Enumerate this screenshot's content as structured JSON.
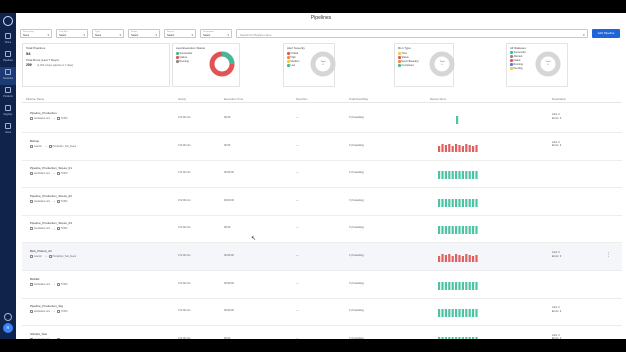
{
  "title": "Pipelines",
  "sidebar": {
    "items": [
      {
        "label": "Home"
      },
      {
        "label": "Pipelines"
      },
      {
        "label": "Networks"
      },
      {
        "label": "Products"
      },
      {
        "label": "Registry"
      },
      {
        "label": "Users"
      }
    ],
    "avatar": "R"
  },
  "filters": [
    {
      "label": "Processing",
      "value": "None"
    },
    {
      "label": "Last Run",
      "value": "Select"
    },
    {
      "label": "Type",
      "value": "None"
    },
    {
      "label": "Status",
      "value": "Select"
    },
    {
      "label": "Source",
      "value": "Select"
    },
    {
      "label": "Destination",
      "value": "Select"
    }
  ],
  "search": {
    "placeholder": "Search for Pipeline name"
  },
  "add_button": "Add Pipeline",
  "cards": {
    "totals": {
      "title": "Total Pipelines",
      "count": "54",
      "runs_label": "Total Runs (Last 7 Days)",
      "runs_value": "259",
      "runs_sub": "(1,183 unique pipeline in 7 days)"
    },
    "run_status": {
      "title": "Last Execution Status",
      "items": [
        {
          "label": "Succeeded",
          "color": "#43b99a"
        },
        {
          "label": "Failure",
          "color": "#e15454"
        },
        {
          "label": "Running",
          "color": "#888888"
        }
      ],
      "center": "Total\n54"
    },
    "alerts": {
      "title": "Alert Severity",
      "items": [
        {
          "label": "Critical",
          "color": "#e15454"
        },
        {
          "label": "High",
          "color": "#f08a3c"
        },
        {
          "label": "Medium",
          "color": "#f2c94c"
        },
        {
          "label": "Low",
          "color": "#43b99a"
        }
      ],
      "center": "Total\n0"
    },
    "types": {
      "title": "Run Type",
      "items": [
        {
          "label": "Time",
          "color": "#f2c94c"
        },
        {
          "label": "Status",
          "color": "#e15454"
        },
        {
          "label": "Event Based(s)",
          "color": "#f08a3c"
        },
        {
          "label": "Completed",
          "color": "#43b99a"
        }
      ],
      "center": "Total\n0"
    },
    "statuses": {
      "title": "All Statuses",
      "items": [
        {
          "label": "Successful",
          "color": "#43b99a"
        },
        {
          "label": "Aborted",
          "color": "#888888"
        },
        {
          "label": "Failed",
          "color": "#e15454"
        },
        {
          "label": "Running",
          "color": "#4e7fd8"
        },
        {
          "label": "Pending",
          "color": "#f2c94c"
        }
      ],
      "center": "Total\n0"
    }
  },
  "table": {
    "headers": [
      "Pipeline Name",
      "Hourly",
      "Execution Time",
      "Next Run",
      "Total Runs/Day",
      "Recent Runs",
      "Destination"
    ],
    "rows": [
      {
        "name": "Pipeline_Production",
        "source": "destination.com",
        "target": "TOPIC",
        "hourly": "0 hr:00 min",
        "exec": "00:00",
        "next": "—",
        "total": "3 (Yesterday)",
        "runs": "green1",
        "dest": "Jobs: 0\nErrors: 0",
        "hl": false
      },
      {
        "name": "Bishop",
        "source": "Lowmin",
        "target": "Production_Test_Event",
        "hourly": "0 hr:00 min",
        "exec": "00:00",
        "next": "—",
        "total": "3 (Yesterday)",
        "runs": "red",
        "dest": "Jobs: 0\nErrors: 0",
        "hl": false
      },
      {
        "name": "Pipeline_Production_Stress_01",
        "source": "destination.com",
        "target": "TOPIC",
        "hourly": "0 hr:00 min",
        "exec": "00:00:00",
        "next": "—",
        "total": "3 (Yesterday)",
        "runs": "green",
        "dest": "",
        "hl": false
      },
      {
        "name": "Pipeline_Production_Stress_02",
        "source": "destination.com",
        "target": "TOPIC",
        "hourly": "0 hr:00 min",
        "exec": "00:00:00",
        "next": "—",
        "total": "3 (Yesterday)",
        "runs": "green",
        "dest": "",
        "hl": false
      },
      {
        "name": "Pipeline_Production_Stress_03",
        "source": "destination.com",
        "target": "TOPIC",
        "hourly": "0 hr:00 min",
        "exec": "00:00",
        "next": "—",
        "total": "3 (Yesterday)",
        "runs": "green",
        "dest": "",
        "hl": false
      },
      {
        "name": "Bick_Pullout_All",
        "source": "Lowmin",
        "target": "Production_Test_Event",
        "hourly": "0 hr:00 min",
        "exec": "00:00:00",
        "next": "—",
        "total": "3 (Yesterday)",
        "runs": "red",
        "dest": "Jobs: 0\nErrors: 0",
        "hl": true
      },
      {
        "name": "BAKE1",
        "source": "destination.com",
        "target": "TOPIC",
        "hourly": "0 hr:00 min",
        "exec": "00:00:00",
        "next": "—",
        "total": "3 (Yesterday)",
        "runs": "green",
        "dest": "",
        "hl": false
      },
      {
        "name": "Pipeline_Production_Stg",
        "source": "destination.com",
        "target": "TOPIC",
        "hourly": "0 hr:00 min",
        "exec": "00:00:00",
        "next": "—",
        "total": "3 (Yesterday)",
        "runs": "green",
        "dest": "Jobs: 0\nErrors: 0",
        "hl": false
      },
      {
        "name": "Shinkel_Test",
        "source": "destination.com",
        "target": "TOPIC",
        "hourly": "0 hr:00 min",
        "exec": "00:00",
        "next": "—",
        "total": "3 (Yesterday)",
        "runs": "green",
        "dest": "Jobs: 0\nErrors: 0",
        "hl": false
      }
    ]
  }
}
